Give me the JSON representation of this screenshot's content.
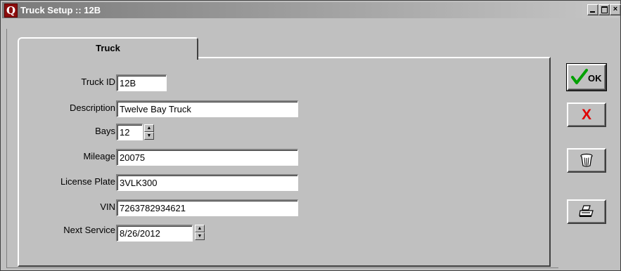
{
  "window": {
    "app_icon_letter": "Q",
    "title": "Truck Setup :: 12B",
    "minimize_glyph": "_",
    "maximize_glyph": "□",
    "close_glyph": "×"
  },
  "tabs": [
    {
      "label": "Truck",
      "active": true
    }
  ],
  "form": {
    "truck_id": {
      "label": "Truck ID",
      "value": "12B"
    },
    "description": {
      "label": "Description",
      "value": "Twelve Bay Truck"
    },
    "bays": {
      "label": "Bays",
      "value": "12"
    },
    "mileage": {
      "label": "Mileage",
      "value": "20075"
    },
    "license_plate": {
      "label": "License Plate",
      "value": "3VLK300"
    },
    "vin": {
      "label": "VIN",
      "value": "7263782934621"
    },
    "next_service": {
      "label": "Next Service",
      "value": "8/26/2012"
    }
  },
  "spinner": {
    "up_glyph": "▲",
    "down_glyph": "▼"
  },
  "buttons": {
    "ok": {
      "label": "OK",
      "icon": "checkmark-icon",
      "accent": "#00a000"
    },
    "cancel": {
      "glyph": "X",
      "icon": "cancel-x-icon",
      "accent": "#e00000"
    },
    "delete": {
      "icon": "trash-can-icon"
    },
    "print": {
      "icon": "printer-icon"
    }
  }
}
